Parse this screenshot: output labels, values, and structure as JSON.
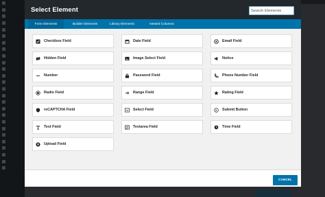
{
  "modal": {
    "title": "Select Element",
    "search_placeholder": "Search Elements"
  },
  "tabs": [
    {
      "label": "Form Elements",
      "active": true
    },
    {
      "label": "Builder Elements",
      "active": false
    },
    {
      "label": "Library Elements",
      "active": false
    },
    {
      "label": "Nested Columns",
      "active": false
    }
  ],
  "elements": [
    {
      "label": "Checkbox Field",
      "icon": "checkbox-icon"
    },
    {
      "label": "Date Field",
      "icon": "calendar-icon"
    },
    {
      "label": "Email Field",
      "icon": "at-sign-icon"
    },
    {
      "label": "Hidden Field",
      "icon": "eye-slash-icon"
    },
    {
      "label": "Image Select Field",
      "icon": "image-icon"
    },
    {
      "label": "Notice",
      "icon": "megaphone-icon"
    },
    {
      "label": "Number",
      "icon": "minus-icon"
    },
    {
      "label": "Password Field",
      "icon": "lock-icon"
    },
    {
      "label": "Phone Number Field",
      "icon": "phone-icon"
    },
    {
      "label": "Radio Field",
      "icon": "radio-icon"
    },
    {
      "label": "Range Field",
      "icon": "arrow-right-icon"
    },
    {
      "label": "Rating Field",
      "icon": "star-icon"
    },
    {
      "label": "reCAPTCHA Field",
      "icon": "shield-icon"
    },
    {
      "label": "Select Field",
      "icon": "select-icon"
    },
    {
      "label": "Submit Button",
      "icon": "send-icon"
    },
    {
      "label": "Text Field",
      "icon": "text-icon"
    },
    {
      "label": "Textarea Field",
      "icon": "textarea-icon"
    },
    {
      "label": "Time Field",
      "icon": "clock-icon"
    },
    {
      "label": "Upload Field",
      "icon": "upload-icon"
    }
  ],
  "footer": {
    "cancel_label": "CANCEL"
  },
  "colors": {
    "header": "#23282d",
    "accent": "#0073aa"
  }
}
